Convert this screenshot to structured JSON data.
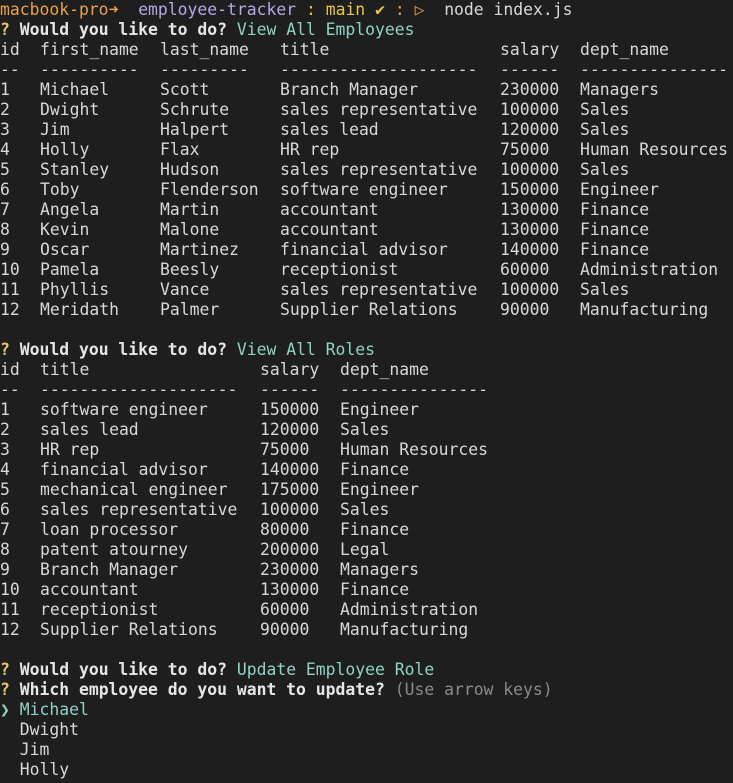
{
  "prompt": {
    "host": "macbook-pro",
    "arrow": "➜",
    "dir": "employee-tracker",
    "git_sep": ":",
    "branch": "main",
    "check": "✔",
    "sep2": ":",
    "symbol": "▷",
    "command": "node index.js"
  },
  "q1": {
    "mark": "?",
    "text": "Would you like to do?",
    "answer": "View All Employees"
  },
  "employees": {
    "headers": [
      "id",
      "first_name",
      "last_name",
      "title",
      "salary",
      "dept_name"
    ],
    "dividers": [
      "--",
      "----------",
      "---------",
      "--------------------",
      "------",
      "---------------"
    ],
    "rows": [
      [
        "1",
        "Michael",
        "Scott",
        "Branch Manager",
        "230000",
        "Managers"
      ],
      [
        "2",
        "Dwight",
        "Schrute",
        "sales representative",
        "100000",
        "Sales"
      ],
      [
        "3",
        "Jim",
        "Halpert",
        "sales lead",
        "120000",
        "Sales"
      ],
      [
        "4",
        "Holly",
        "Flax",
        "HR rep",
        "75000",
        "Human Resources"
      ],
      [
        "5",
        "Stanley",
        "Hudson",
        "sales representative",
        "100000",
        "Sales"
      ],
      [
        "6",
        "Toby",
        "Flenderson",
        "software engineer",
        "150000",
        "Engineer"
      ],
      [
        "7",
        "Angela",
        "Martin",
        "accountant",
        "130000",
        "Finance"
      ],
      [
        "8",
        "Kevin",
        "Malone",
        "accountant",
        "130000",
        "Finance"
      ],
      [
        "9",
        "Oscar",
        "Martinez",
        "financial advisor",
        "140000",
        "Finance"
      ],
      [
        "10",
        "Pamela",
        "Beesly",
        "receptionist",
        "60000",
        "Administration"
      ],
      [
        "11",
        "Phyllis",
        "Vance",
        "sales representative",
        "100000",
        "Sales"
      ],
      [
        "12",
        "Meridath",
        "Palmer",
        "Supplier Relations",
        "90000",
        "Manufacturing"
      ]
    ]
  },
  "q2": {
    "mark": "?",
    "text": "Would you like to do?",
    "answer": "View All Roles"
  },
  "roles": {
    "headers": [
      "id",
      "title",
      "salary",
      "dept_name"
    ],
    "dividers": [
      "--",
      "--------------------",
      "------",
      "---------------"
    ],
    "rows": [
      [
        "1",
        "software engineer",
        "150000",
        "Engineer"
      ],
      [
        "2",
        "sales lead",
        "120000",
        "Sales"
      ],
      [
        "3",
        "HR rep",
        "75000",
        "Human Resources"
      ],
      [
        "4",
        "financial advisor",
        "140000",
        "Finance"
      ],
      [
        "5",
        "mechanical engineer",
        "175000",
        "Engineer"
      ],
      [
        "6",
        "sales representative",
        "100000",
        "Sales"
      ],
      [
        "7",
        "loan processor",
        "80000",
        "Finance"
      ],
      [
        "8",
        "patent atourney",
        "200000",
        "Legal"
      ],
      [
        "9",
        "Branch Manager",
        "230000",
        "Managers"
      ],
      [
        "10",
        "accountant",
        "130000",
        "Finance"
      ],
      [
        "11",
        "receptionist",
        "60000",
        "Administration"
      ],
      [
        "12",
        "Supplier Relations",
        "90000",
        "Manufacturing"
      ]
    ]
  },
  "q3": {
    "mark": "?",
    "text": "Would you like to do?",
    "answer": "Update Employee Role"
  },
  "q4": {
    "mark": "?",
    "text": "Which employee do you want to update?",
    "hint": "(Use arrow keys)"
  },
  "choices": {
    "pointer": "❯",
    "items": [
      "Michael",
      "Dwight",
      "Jim",
      "Holly"
    ]
  }
}
